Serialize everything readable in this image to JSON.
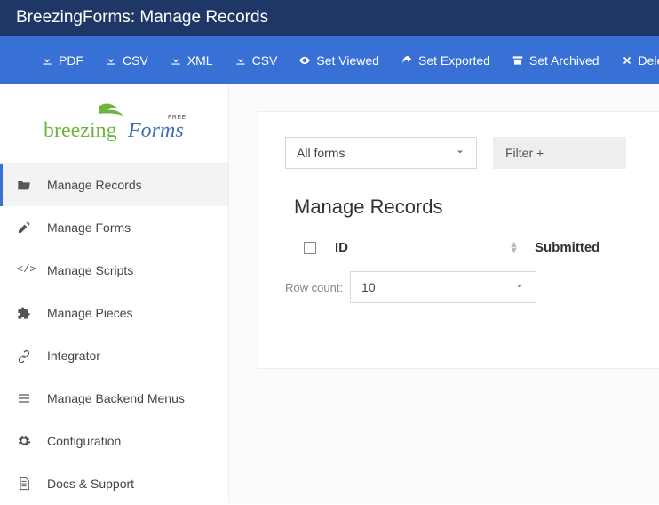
{
  "titlebar": {
    "title": "BreezingForms: Manage Records"
  },
  "toolbar": {
    "pdf": "PDF",
    "csv1": "CSV",
    "xml": "XML",
    "csv2": "CSV",
    "set_viewed": "Set Viewed",
    "set_exported": "Set Exported",
    "set_archived": "Set Archived",
    "delete": "Delete"
  },
  "logo": {
    "text_main": "breezing",
    "text_sub": "Forms",
    "badge": "FREE"
  },
  "sidebar": {
    "items": [
      {
        "label": "Manage Records"
      },
      {
        "label": "Manage Forms"
      },
      {
        "label": "Manage Scripts"
      },
      {
        "label": "Manage Pieces"
      },
      {
        "label": "Integrator"
      },
      {
        "label": "Manage Backend Menus"
      },
      {
        "label": "Configuration"
      },
      {
        "label": "Docs & Support"
      }
    ]
  },
  "content": {
    "form_select": "All forms",
    "filter_btn": "Filter +",
    "section_title": "Manage Records",
    "columns": {
      "id": "ID",
      "submitted": "Submitted"
    },
    "rowcount_label": "Row count:",
    "rowcount_value": "10"
  }
}
